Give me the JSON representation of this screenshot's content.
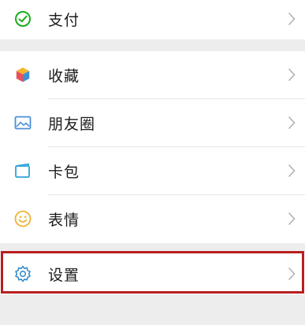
{
  "menu": {
    "pay": {
      "label": "支付",
      "icon": "wechat-pay-icon"
    },
    "favorites": {
      "label": "收藏",
      "icon": "favorites-cube-icon"
    },
    "moments": {
      "label": "朋友圈",
      "icon": "moments-picture-icon"
    },
    "card_wallet": {
      "label": "卡包",
      "icon": "card-wallet-icon"
    },
    "stickers": {
      "label": "表情",
      "icon": "smiley-icon"
    },
    "settings": {
      "label": "设置",
      "icon": "gear-icon"
    }
  },
  "colors": {
    "pay_green": "#1aad19",
    "highlight_red": "#b81e1e",
    "settings_blue": "#3a8ec8",
    "chevron": "#b2b2b2"
  }
}
